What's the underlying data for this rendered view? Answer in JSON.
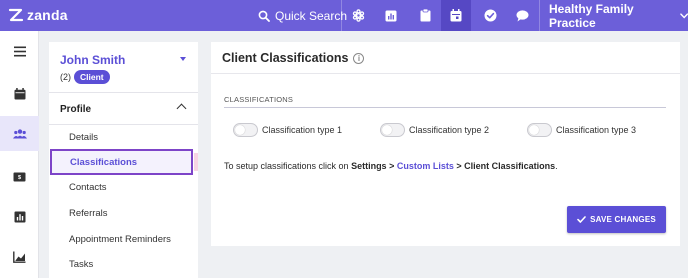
{
  "topbar": {
    "logo": "zanda",
    "search_label": "Quick Search",
    "practice_name": "Healthy Family Practice",
    "icons": [
      "settings-cog-icon",
      "reports-chart-icon",
      "clipboard-icon",
      "calendar-icon",
      "check-circle-icon",
      "chat-icon"
    ],
    "accent": "#6c5fd9"
  },
  "leftnav": {
    "icons": [
      "menu-icon",
      "calendar-icon",
      "clients-icon",
      "billing-icon",
      "reports-icon",
      "analytics-icon"
    ]
  },
  "client": {
    "name": "John Smith",
    "count": "(2)",
    "badge": "Client"
  },
  "sidebar": {
    "section": "Profile",
    "items": [
      {
        "label": "Details"
      },
      {
        "label": "Classifications"
      },
      {
        "label": "Contacts"
      },
      {
        "label": "Referrals"
      },
      {
        "label": "Appointment Reminders"
      },
      {
        "label": "Tasks"
      }
    ]
  },
  "main": {
    "title": "Client Classifications",
    "section_heading": "CLASSIFICATIONS",
    "toggles": [
      {
        "label": "Classification type 1",
        "on": false
      },
      {
        "label": "Classification type 2",
        "on": false
      },
      {
        "label": "Classification type 3",
        "on": false
      }
    ],
    "setup": {
      "prefix": "To setup classifications click on ",
      "settings": "Settings",
      "sep1": " > ",
      "custom_lists": "Custom Lists",
      "sep2": " > ",
      "client_classifications": "Client Classifications",
      "suffix": "."
    },
    "save_label": "SAVE CHANGES"
  }
}
